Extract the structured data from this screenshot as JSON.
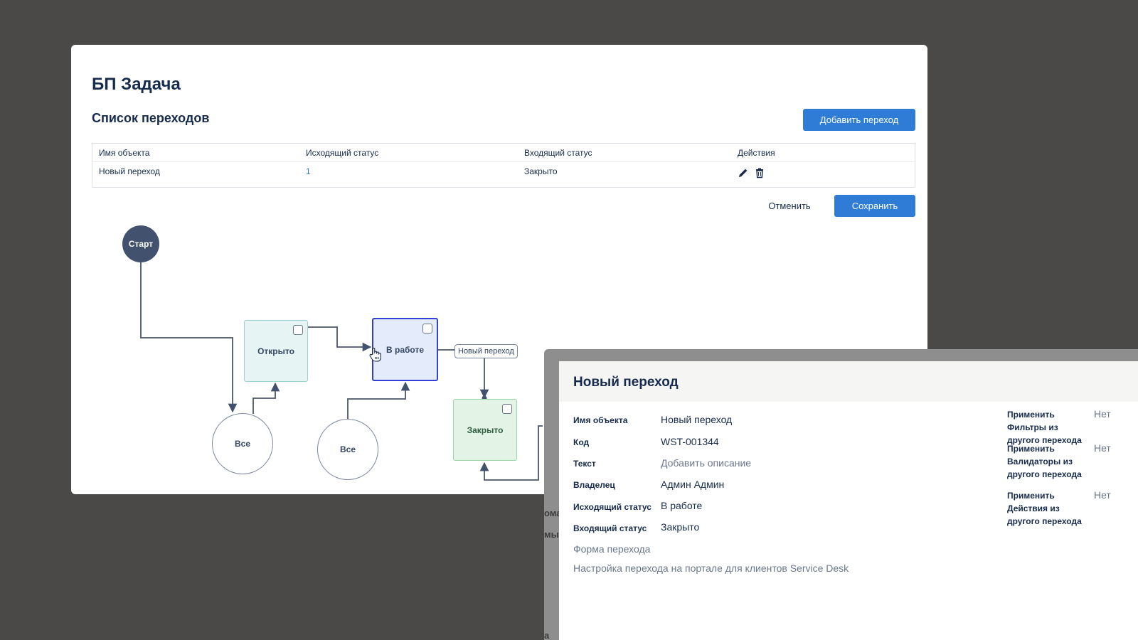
{
  "page": {
    "title": "БП Задача",
    "section_title": "Список переходов"
  },
  "toolbar": {
    "add_label": "Добавить переход",
    "cancel_label": "Отменить",
    "save_label": "Сохранить"
  },
  "table": {
    "headers": [
      "Имя объекта",
      "Исходящий статус",
      "Входящий статус",
      "Действия"
    ],
    "rows": [
      {
        "name": "Новый переход",
        "source": "1",
        "target": "Закрыто"
      }
    ]
  },
  "diagram": {
    "start": "Старт",
    "statuses": {
      "open": "Открыто",
      "in_progress": "В работе",
      "closed": "Закрыто"
    },
    "all_1": "Все",
    "all_2": "Все",
    "transition_label": "Новый переход"
  },
  "panel": {
    "title": "Новый переход",
    "strip": {
      "a": "ома",
      "b": "мы",
      "c": "а"
    },
    "fields": {
      "name_label": "Имя объекта",
      "name_value": "Новый переход",
      "code_label": "Код",
      "code_value": "WST-001344",
      "text_label": "Текст",
      "text_value": "Добавить описание",
      "owner_label": "Владелец",
      "owner_value": "Админ Админ",
      "source_label": "Исходящий статус",
      "source_value": "В работе",
      "target_label": "Входящий статус",
      "target_value": "Закрыто"
    },
    "form_link": "Форма перехода",
    "portal_link": "Настройка перехода на портале для клиентов Service Desk",
    "side": {
      "filters_label": "Применить Фильтры из другого перехода",
      "filters_value": "Нет",
      "validators_label": "Применить Валидаторы из другого перехода",
      "validators_value": "Нет",
      "actions_label": "Применить Действия из другого перехода",
      "actions_value": "Нет"
    }
  },
  "colors": {
    "primary": "#2f7cd6",
    "background": "#4a4947",
    "selected_border": "#3340d6"
  }
}
